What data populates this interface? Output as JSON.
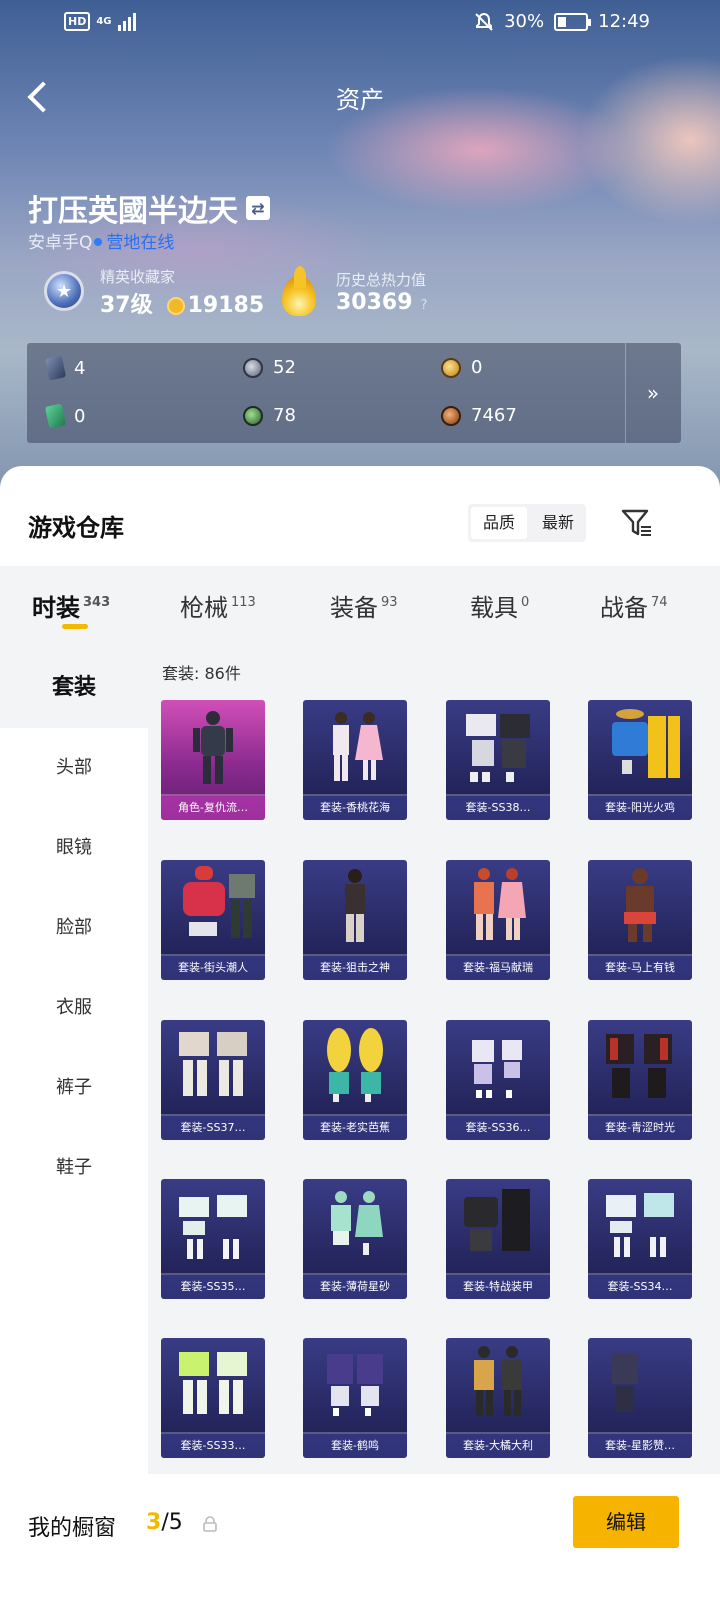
{
  "status_bar": {
    "network": "HD",
    "signal_text": "4G",
    "battery": "30%",
    "time": "12:49"
  },
  "nav": {
    "title": "资产"
  },
  "profile": {
    "nickname": "打压英國半边天",
    "account": "安卓手Q",
    "status": "营地在线"
  },
  "rank": {
    "title": "精英收藏家",
    "level": "37级",
    "points": "19185"
  },
  "heat": {
    "title": "历史总热力值",
    "value": "30369",
    "help": "?"
  },
  "currencies": {
    "card_a": "4",
    "silver": "52",
    "gold": "0",
    "card_b": "0",
    "orb": "78",
    "bronze": "7467",
    "more": "»"
  },
  "warehouse": {
    "title": "游戏仓库",
    "sort_quality": "品质",
    "sort_latest": "最新"
  },
  "tabs": [
    {
      "label": "时装",
      "count": "343"
    },
    {
      "label": "枪械",
      "count": "113"
    },
    {
      "label": "装备",
      "count": "93"
    },
    {
      "label": "载具",
      "count": "0"
    },
    {
      "label": "战备",
      "count": "74"
    }
  ],
  "categories": [
    "套装",
    "头部",
    "眼镜",
    "脸部",
    "衣服",
    "裤子",
    "鞋子"
  ],
  "grid": {
    "count_label": "套装: 86件",
    "items": [
      "角色-复仇流…",
      "套装-香桃花海",
      "套装-SS38…",
      "套装-阳光火鸡",
      "套装-街头潮人",
      "套装-狙击之神",
      "套装-福马献瑞",
      "套装-马上有钱",
      "套装-SS37…",
      "套装-老实芭蕉",
      "套装-SS36…",
      "套装-青涩时光",
      "套装-SS35…",
      "套装-薄荷星砂",
      "套装-特战装甲",
      "套装-SS34…",
      "套装-SS33…",
      "套装-鹤鸣",
      "套装-大橘大利",
      "套装-星影赞…"
    ]
  },
  "showcase": {
    "label": "我的橱窗",
    "current": "3",
    "total": "/5",
    "edit": "编辑"
  }
}
